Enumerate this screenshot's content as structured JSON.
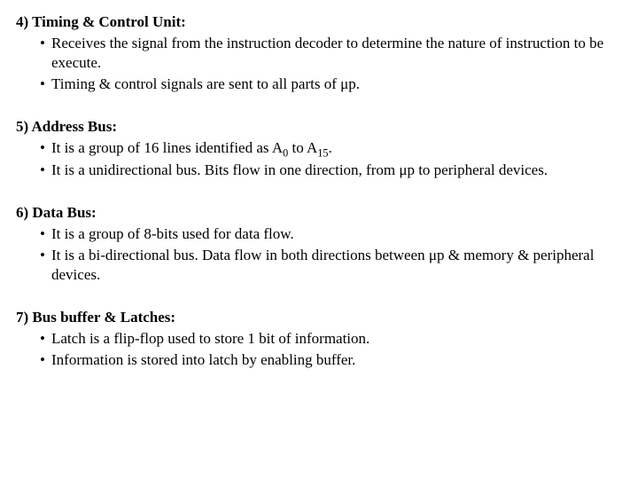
{
  "sections": [
    {
      "num": "4)",
      "title": "Timing & Control Unit:",
      "bullets": [
        "Receives the signal from the instruction decoder to determine the nature of instruction to be execute.",
        "Timing & control signals are sent to all parts of μp."
      ]
    },
    {
      "num": "5)",
      "title": "Address Bus:",
      "bullets": [
        "It is a group of 16 lines identified as A{sub0} to A{sub15}.",
        "It is a unidirectional bus. Bits flow in one direction, from μp to peripheral devices."
      ]
    },
    {
      "num": "6)",
      "title": "Data Bus:",
      "bullets": [
        "It is a group of 8-bits used for data flow.",
        "It is a bi-directional bus. Data flow in both directions between μp & memory & peripheral devices."
      ]
    },
    {
      "num": "7)",
      "title": "Bus buffer & Latches:",
      "bullets": [
        "Latch is a flip-flop used to store 1 bit of information.",
        "Information is stored into latch by enabling buffer."
      ]
    }
  ]
}
